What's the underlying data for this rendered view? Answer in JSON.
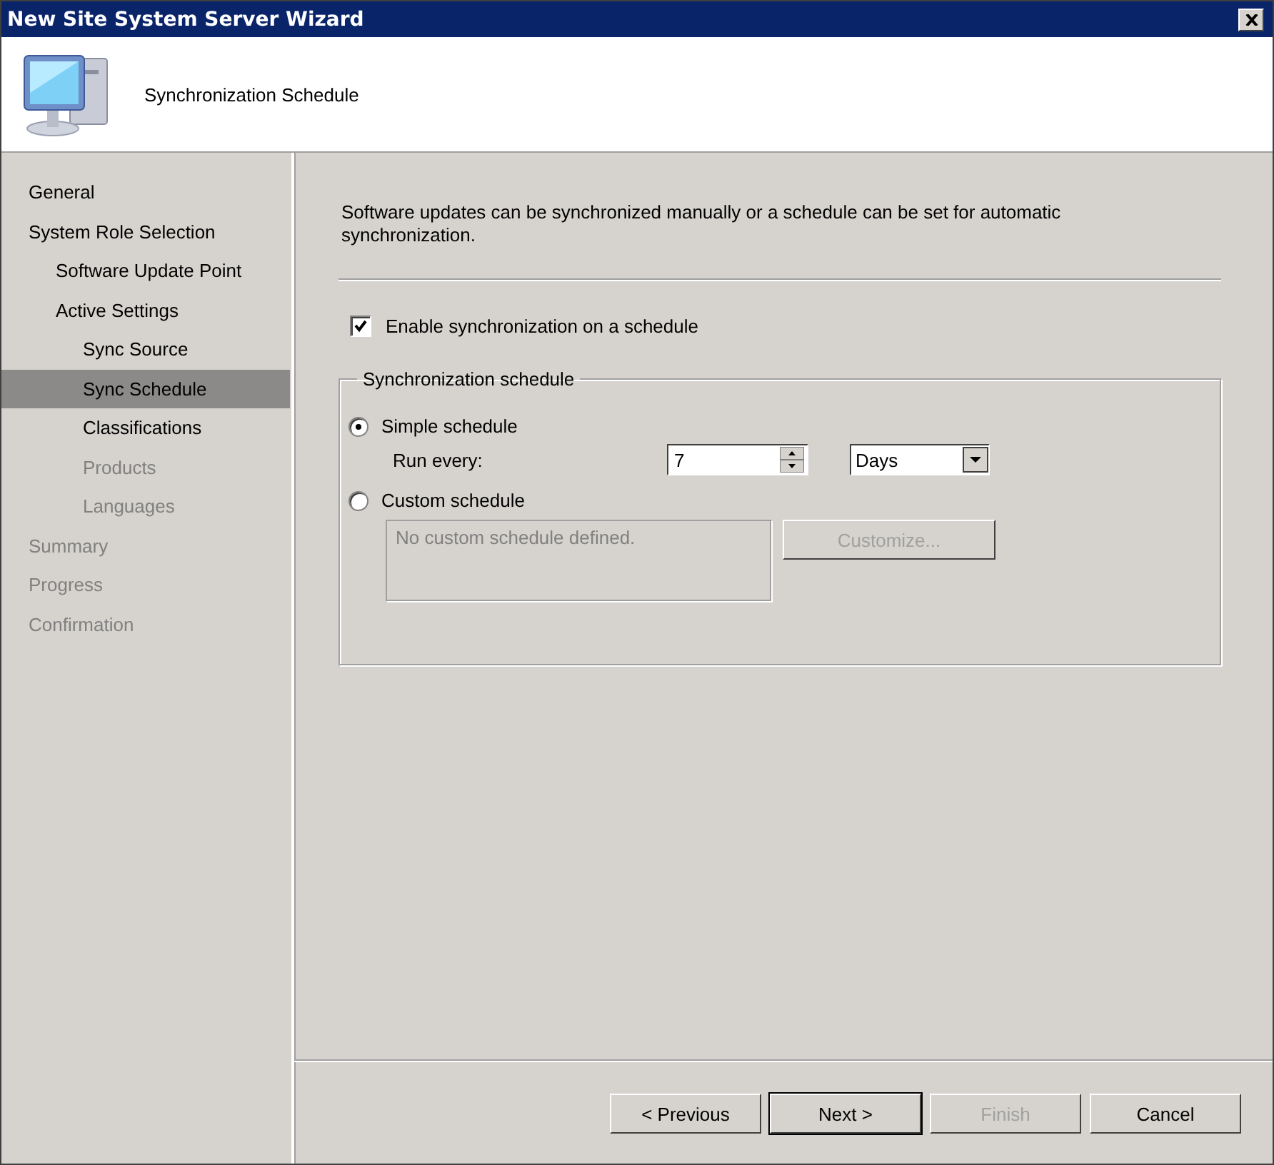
{
  "window": {
    "title": "New Site System Server Wizard"
  },
  "header": {
    "title": "Synchronization Schedule"
  },
  "sidebar": {
    "items": [
      {
        "label": "General",
        "selected": false,
        "disabled": false
      },
      {
        "label": "System Role Selection",
        "selected": false,
        "disabled": false,
        "children": [
          {
            "label": "Software Update Point",
            "selected": false,
            "disabled": false
          },
          {
            "label": "Active Settings",
            "selected": false,
            "disabled": false,
            "children": [
              {
                "label": "Sync Source",
                "selected": false,
                "disabled": false
              },
              {
                "label": "Sync Schedule",
                "selected": true,
                "disabled": false
              },
              {
                "label": "Classifications",
                "selected": false,
                "disabled": false
              },
              {
                "label": "Products",
                "selected": false,
                "disabled": true
              },
              {
                "label": "Languages",
                "selected": false,
                "disabled": true
              }
            ]
          }
        ]
      },
      {
        "label": "Summary",
        "selected": false,
        "disabled": true
      },
      {
        "label": "Progress",
        "selected": false,
        "disabled": true
      },
      {
        "label": "Confirmation",
        "selected": false,
        "disabled": true
      }
    ]
  },
  "intro": "Software updates can be synchronized manually or a schedule can be set for automatic synchronization.",
  "enable_checkbox": {
    "label": "Enable synchronization on a schedule",
    "checked": true
  },
  "schedule_group": {
    "title": "Synchronization schedule",
    "options": [
      {
        "label": "Simple schedule",
        "selected": true
      },
      {
        "label": "Custom schedule",
        "selected": false
      }
    ],
    "run_every": {
      "label": "Run every:",
      "value": "7",
      "unit": "Days"
    },
    "custom_summary": "No custom schedule defined.",
    "customize_button": {
      "label": "Customize...",
      "disabled": true
    }
  },
  "buttons": [
    {
      "label": "< Previous",
      "disabled": false,
      "default": false
    },
    {
      "label": "Next >",
      "disabled": false,
      "default": true
    },
    {
      "label": "Finish",
      "disabled": true,
      "default": false
    },
    {
      "label": "Cancel",
      "disabled": false,
      "default": false
    }
  ]
}
